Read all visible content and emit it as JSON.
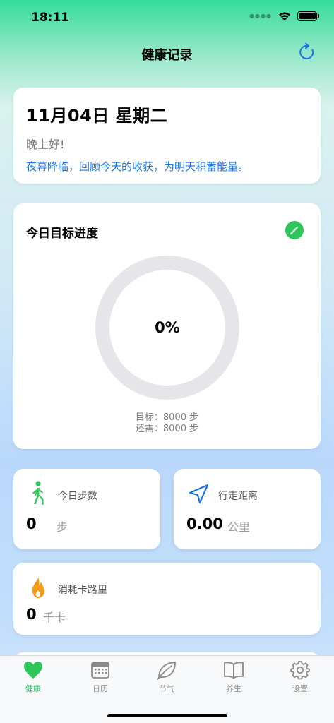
{
  "status": {
    "time": "18:11"
  },
  "nav": {
    "title": "健康记录",
    "refresh_icon": "refresh-icon"
  },
  "date_card": {
    "date": "11月04日 星期二",
    "greeting": "晚上好!",
    "message": "夜幕降临，回顾今天的收获，为明天积蓄能量。"
  },
  "goal": {
    "title": "今日目标进度",
    "progress_text": "0%",
    "progress": 0,
    "target_line": "目标：8000 步",
    "remaining_line": "还需：8000 步"
  },
  "steps": {
    "label": "今日步数",
    "value": "0",
    "unit": "步"
  },
  "distance": {
    "label": "行走距离",
    "value": "0.00",
    "unit": "公里"
  },
  "calories": {
    "label": "消耗卡路里",
    "value": "0",
    "unit": "千卡"
  },
  "tabs": [
    {
      "label": "健康",
      "icon": "heart-icon",
      "active": true
    },
    {
      "label": "日历",
      "icon": "calendar-icon",
      "active": false
    },
    {
      "label": "节气",
      "icon": "leaf-icon",
      "active": false
    },
    {
      "label": "养生",
      "icon": "book-icon",
      "active": false
    },
    {
      "label": "设置",
      "icon": "gear-icon",
      "active": false
    }
  ],
  "colors": {
    "accent_green": "#30c55a",
    "accent_blue": "#1a73e8",
    "ring_track": "#e6e6ea"
  }
}
